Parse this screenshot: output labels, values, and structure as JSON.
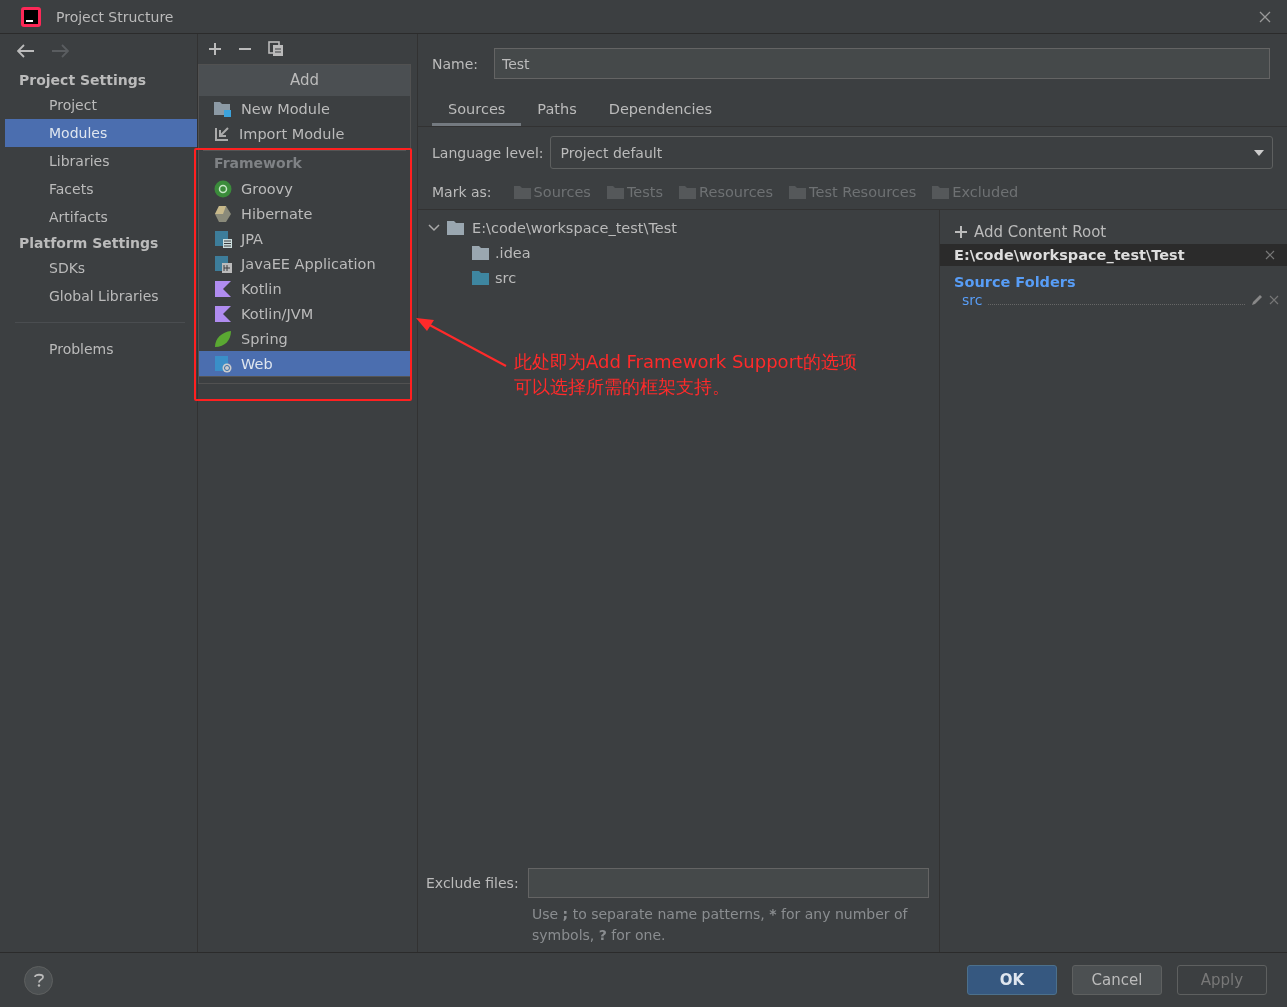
{
  "window": {
    "title": "Project Structure"
  },
  "sidebar": {
    "groups": [
      {
        "title": "Project Settings",
        "items": [
          {
            "label": "Project",
            "selected": false
          },
          {
            "label": "Modules",
            "selected": true
          },
          {
            "label": "Libraries",
            "selected": false
          },
          {
            "label": "Facets",
            "selected": false
          },
          {
            "label": "Artifacts",
            "selected": false
          }
        ]
      },
      {
        "title": "Platform Settings",
        "items": [
          {
            "label": "SDKs",
            "selected": false
          },
          {
            "label": "Global Libraries",
            "selected": false
          }
        ]
      }
    ],
    "problems": {
      "label": "Problems",
      "selected": false
    }
  },
  "add_popup": {
    "title": "Add",
    "items": [
      {
        "label": "New Module",
        "kind": "module",
        "selected": false
      },
      {
        "label": "Import Module",
        "kind": "import",
        "selected": false
      }
    ],
    "framework": {
      "title": "Framework",
      "items": [
        {
          "label": "Groovy",
          "kind": "groovy",
          "selected": false
        },
        {
          "label": "Hibernate",
          "kind": "hibernate",
          "selected": false
        },
        {
          "label": "JPA",
          "kind": "jpa",
          "selected": false
        },
        {
          "label": "JavaEE Application",
          "kind": "javaee",
          "selected": false
        },
        {
          "label": "Kotlin",
          "kind": "kotlin",
          "selected": false
        },
        {
          "label": "Kotlin/JVM",
          "kind": "kotlin",
          "selected": false
        },
        {
          "label": "Spring",
          "kind": "spring",
          "selected": false
        },
        {
          "label": "Web",
          "kind": "web",
          "selected": true
        }
      ]
    }
  },
  "module": {
    "name_label": "Name:",
    "name": "Test",
    "tabs": [
      {
        "label": "Sources",
        "selected": true
      },
      {
        "label": "Paths",
        "selected": false
      },
      {
        "label": "Dependencies",
        "selected": false
      }
    ],
    "language_label": "Language level:",
    "language": "Project default",
    "mark_label": "Mark as:",
    "mark_as": [
      {
        "label": "Sources",
        "disabled": true
      },
      {
        "label": "Tests",
        "disabled": true
      },
      {
        "label": "Resources",
        "disabled": true
      },
      {
        "label": "Test Resources",
        "disabled": true
      },
      {
        "label": "Excluded",
        "disabled": true
      }
    ],
    "tree": {
      "label": "E:\\code\\workspace_test\\Test",
      "expanded": true,
      "children": [
        {
          "label": ".idea",
          "kind": "plain"
        },
        {
          "label": "src",
          "kind": "source"
        }
      ]
    },
    "exclude_label": "Exclude files:",
    "hint": [
      {
        "text": "Use ",
        "bold": false
      },
      {
        "text": ";",
        "bold": true
      },
      {
        "text": " to separate name patterns, ",
        "bold": false
      },
      {
        "text": "*",
        "bold": true
      },
      {
        "text": " for any number of symbols, ",
        "bold": false
      },
      {
        "text": "?",
        "bold": true
      },
      {
        "text": " for one.",
        "bold": false
      }
    ],
    "content_root": {
      "add": "Add Content Root",
      "path": "E:\\code\\workspace_test\\Test",
      "section": "Source Folders",
      "folders": [
        "src"
      ]
    }
  },
  "annotation": {
    "lines": [
      "此处即为Add Framework Support的选项",
      "可以选择所需的框架支持。"
    ]
  },
  "buttons": [
    {
      "label": "OK",
      "kind": "default",
      "disabled": false
    },
    {
      "label": "Cancel",
      "kind": "normal",
      "disabled": false
    },
    {
      "label": "Apply",
      "kind": "normal",
      "disabled": true
    }
  ]
}
